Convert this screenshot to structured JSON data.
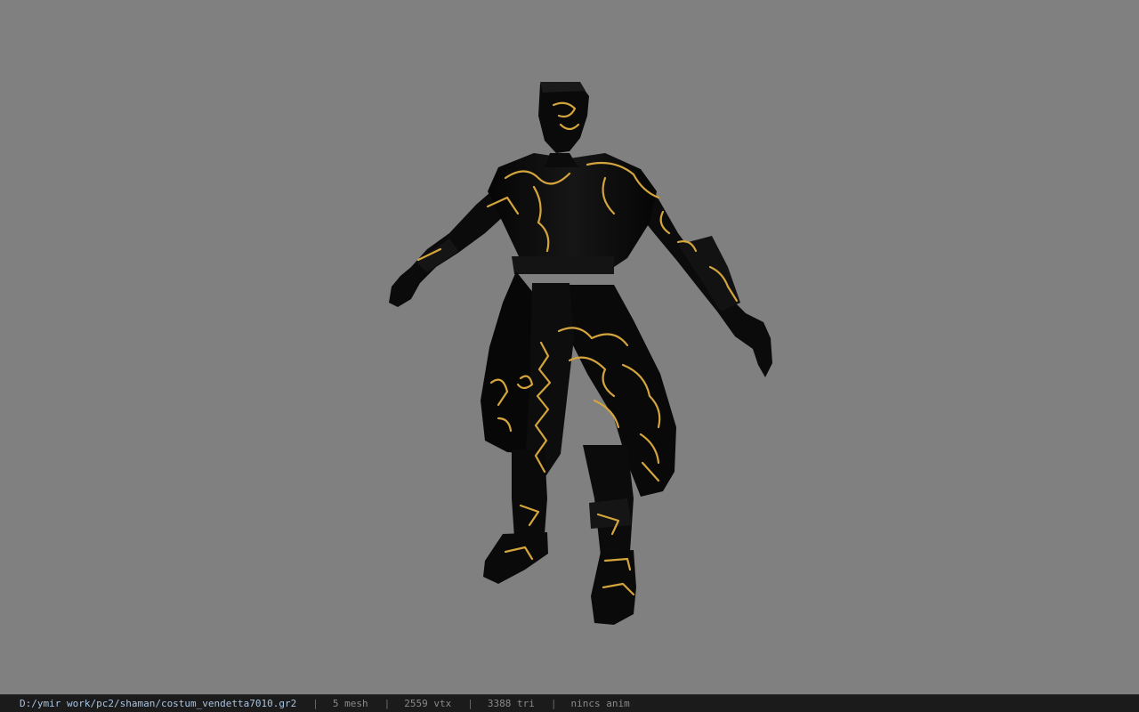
{
  "viewer": {
    "background_color": "#808080",
    "model_colors": {
      "base": "#0a0a0a",
      "pattern": "#d4a53c"
    }
  },
  "status_bar": {
    "file_path": "D:/ymir work/pc2/shaman/costum_vendetta7010.gr2",
    "separator": "|",
    "mesh_count": "5 mesh",
    "vertex_count": "2559 vtx",
    "triangle_count": "3388 tri",
    "animation_status": "nincs anim"
  }
}
